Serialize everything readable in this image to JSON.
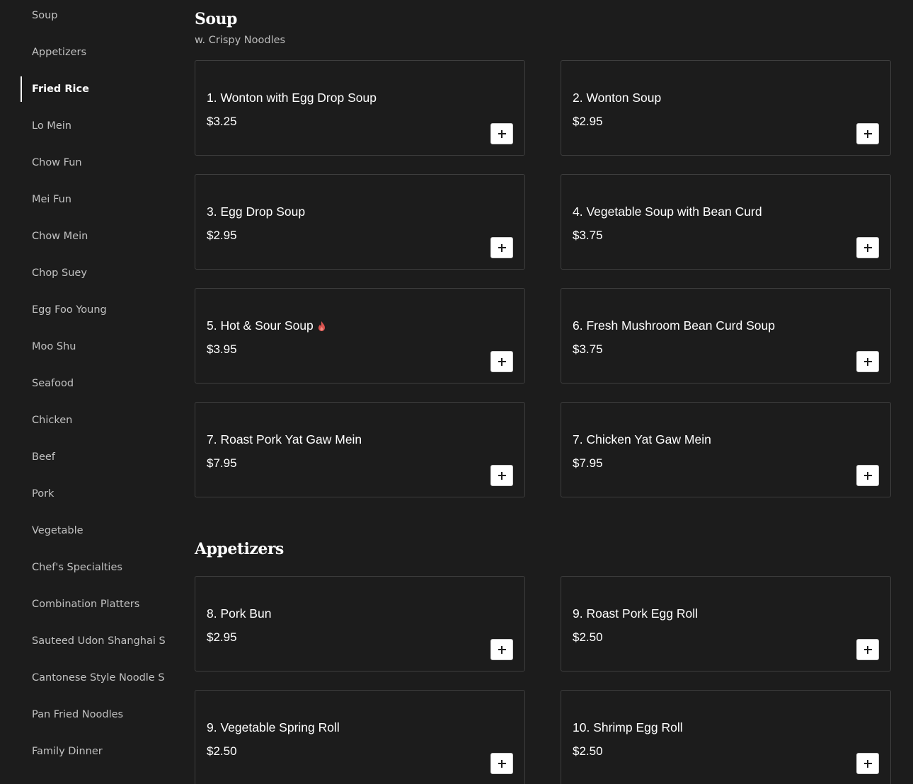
{
  "sidebar": {
    "items": [
      {
        "label": "Soup",
        "active": false
      },
      {
        "label": "Appetizers",
        "active": false
      },
      {
        "label": "Fried Rice",
        "active": true
      },
      {
        "label": "Lo Mein",
        "active": false
      },
      {
        "label": "Chow Fun",
        "active": false
      },
      {
        "label": "Mei Fun",
        "active": false
      },
      {
        "label": "Chow Mein",
        "active": false
      },
      {
        "label": "Chop Suey",
        "active": false
      },
      {
        "label": "Egg Foo Young",
        "active": false
      },
      {
        "label": "Moo Shu",
        "active": false
      },
      {
        "label": "Seafood",
        "active": false
      },
      {
        "label": "Chicken",
        "active": false
      },
      {
        "label": "Beef",
        "active": false
      },
      {
        "label": "Pork",
        "active": false
      },
      {
        "label": "Vegetable",
        "active": false
      },
      {
        "label": "Chef's Specialties",
        "active": false
      },
      {
        "label": "Combination Platters",
        "active": false
      },
      {
        "label": "Sauteed Udon Shanghai S",
        "active": false
      },
      {
        "label": "Cantonese Style Noodle S",
        "active": false
      },
      {
        "label": "Pan Fried Noodles",
        "active": false
      },
      {
        "label": "Family Dinner",
        "active": false
      }
    ]
  },
  "sections": [
    {
      "title": "Soup",
      "subtitle": "w. Crispy Noodles",
      "items": [
        {
          "name": "1. Wonton with Egg Drop Soup",
          "price": "$3.25",
          "spicy": false
        },
        {
          "name": "2. Wonton Soup",
          "price": "$2.95",
          "spicy": false
        },
        {
          "name": "3. Egg Drop Soup",
          "price": "$2.95",
          "spicy": false
        },
        {
          "name": "4. Vegetable Soup with Bean Curd",
          "price": "$3.75",
          "spicy": false
        },
        {
          "name": "5. Hot & Sour Soup",
          "price": "$3.95",
          "spicy": true
        },
        {
          "name": "6. Fresh Mushroom Bean Curd Soup",
          "price": "$3.75",
          "spicy": false
        },
        {
          "name": "7. Roast Pork Yat Gaw Mein",
          "price": "$7.95",
          "spicy": false
        },
        {
          "name": "7. Chicken Yat Gaw Mein",
          "price": "$7.95",
          "spicy": false
        }
      ]
    },
    {
      "title": "Appetizers",
      "subtitle": "",
      "items": [
        {
          "name": "8. Pork Bun",
          "price": "$2.95",
          "spicy": false
        },
        {
          "name": "9. Roast Pork Egg Roll",
          "price": "$2.50",
          "spicy": false
        },
        {
          "name": "9. Vegetable Spring Roll",
          "price": "$2.50",
          "spicy": false
        },
        {
          "name": "10. Shrimp Egg Roll",
          "price": "$2.50",
          "spicy": false
        }
      ]
    }
  ],
  "icons": {
    "add": "plus-icon",
    "spicy": "flame-icon"
  },
  "colors": {
    "background": "#1c1c1c",
    "card_border": "#3e3e3e",
    "text": "#ffffff",
    "muted_text": "#c2c2c2",
    "spicy": "#d9534f"
  }
}
